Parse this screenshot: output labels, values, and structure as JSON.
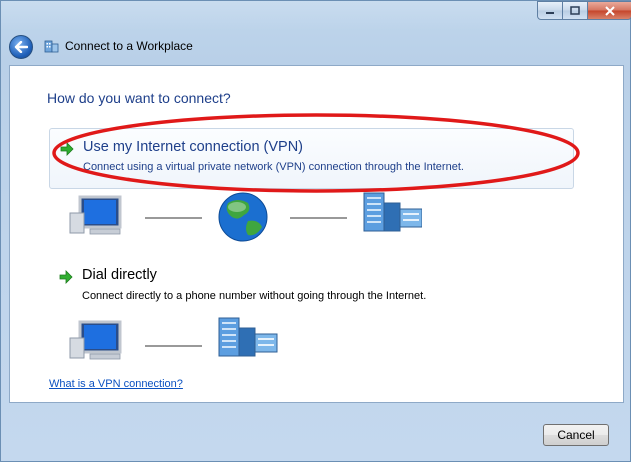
{
  "window": {
    "title": "Connect to a Workplace",
    "controls": {
      "minimize_icon": "minimize-icon",
      "maximize_icon": "maximize-icon",
      "close_icon": "close-icon"
    }
  },
  "content": {
    "heading": "How do you want to connect?",
    "options": [
      {
        "title": "Use my Internet connection (VPN)",
        "description": "Connect using a virtual private network (VPN) connection through the Internet.",
        "icon": "green-arrow-icon",
        "selected": true,
        "diagram": [
          "computer-icon",
          "globe-icon",
          "server-building-icon"
        ]
      },
      {
        "title": "Dial directly",
        "description": "Connect directly to a phone number without going through the Internet.",
        "icon": "green-arrow-icon",
        "selected": false,
        "diagram": [
          "computer-icon",
          "server-building-icon"
        ]
      }
    ],
    "help_link": "What is a VPN connection?"
  },
  "footer": {
    "cancel_label": "Cancel"
  },
  "annotation": {
    "color": "#e01919"
  },
  "colors": {
    "heading": "#1e3f8a",
    "link": "#0b51c1",
    "frame": "#bcd3ea"
  }
}
